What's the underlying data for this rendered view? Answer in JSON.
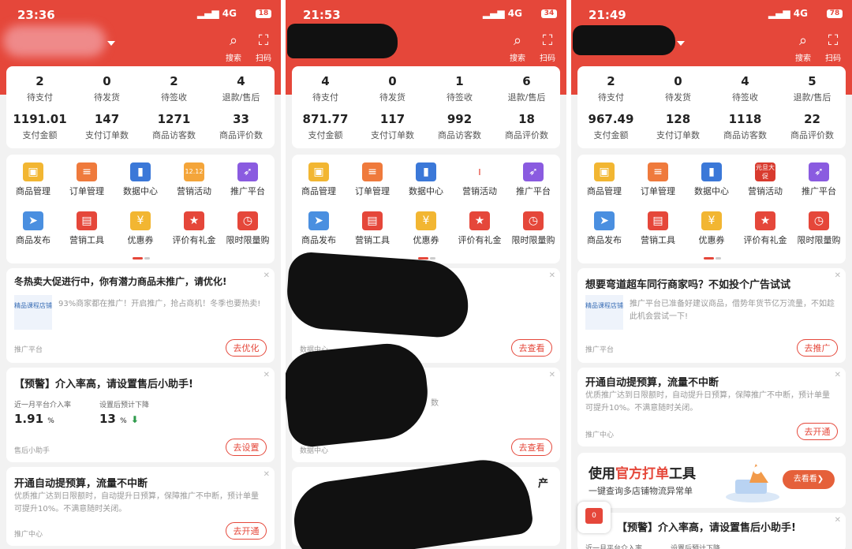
{
  "phones": [
    {
      "status": {
        "time": "23:36",
        "signal": "4G",
        "battery": "18"
      },
      "header": {
        "search": "搜索",
        "scan": "扫码"
      },
      "stats": [
        {
          "value": "2",
          "label": "待支付"
        },
        {
          "value": "0",
          "label": "待发货"
        },
        {
          "value": "2",
          "label": "待签收"
        },
        {
          "value": "4",
          "label": "退款/售后"
        },
        {
          "value": "1191.01",
          "label": "支付金额"
        },
        {
          "value": "147",
          "label": "支付订单数"
        },
        {
          "value": "1271",
          "label": "商品访客数"
        },
        {
          "value": "33",
          "label": "商品评价数"
        }
      ],
      "grid": [
        {
          "label": "商品管理",
          "icon": "bag-icon"
        },
        {
          "label": "订单管理",
          "icon": "scroll-icon"
        },
        {
          "label": "数据中心",
          "icon": "bar-chart-icon"
        },
        {
          "label": "营销活动",
          "icon": "gift-1212-icon",
          "icon_text": "12.12"
        },
        {
          "label": "推广平台",
          "icon": "rocket-icon"
        },
        {
          "label": "商品发布",
          "icon": "paper-plane-icon"
        },
        {
          "label": "营销工具",
          "icon": "toolbox-icon"
        },
        {
          "label": "优惠券",
          "icon": "ticket-icon"
        },
        {
          "label": "评价有礼金",
          "icon": "star-icon"
        },
        {
          "label": "限时限量购",
          "icon": "clock-icon"
        }
      ],
      "cards": {
        "c1": {
          "title": "冬热卖大促进行中，你有潜力商品未推广，请优化!",
          "thumb": "精品课程店铺",
          "desc": "93%商家都在推广！开启推广，抢占商机！冬季也要热卖!",
          "source": "推广平台",
          "button": "去优化"
        },
        "c2": {
          "title": "【预警】介入率高，请设置售后小助手!",
          "m1_label": "近一月平台介入率",
          "m1_value": "1.91",
          "m1_unit": "%",
          "m2_label": "设置后预计下降",
          "m2_value": "13",
          "m2_unit": "%",
          "source": "售后小助手",
          "button": "去设置"
        },
        "c3": {
          "title": "开通自动提预算，流量不中断",
          "desc": "优质推广达到日限额时，自动提升日预算，保障推广不中断，预计单量可提升10%。不满意随时关闭。",
          "source": "推广中心",
          "button": "去开通"
        }
      }
    },
    {
      "status": {
        "time": "21:53",
        "signal": "4G",
        "battery": "34"
      },
      "header": {
        "search": "搜索",
        "scan": "扫码"
      },
      "stats": [
        {
          "value": "4",
          "label": "待支付"
        },
        {
          "value": "0",
          "label": "待发货"
        },
        {
          "value": "1",
          "label": "待签收"
        },
        {
          "value": "6",
          "label": "退款/售后"
        },
        {
          "value": "871.77",
          "label": "支付金额"
        },
        {
          "value": "117",
          "label": "支付订单数"
        },
        {
          "value": "992",
          "label": "商品访客数"
        },
        {
          "value": "18",
          "label": "商品评价数"
        }
      ],
      "grid": [
        {
          "label": "商品管理",
          "icon": "bag-icon"
        },
        {
          "label": "订单管理",
          "icon": "scroll-icon"
        },
        {
          "label": "数据中心",
          "icon": "bar-chart-icon"
        },
        {
          "label": "营销活动",
          "icon": "bar-icon"
        },
        {
          "label": "推广平台",
          "icon": "rocket-icon"
        },
        {
          "label": "商品发布",
          "icon": "paper-plane-icon"
        },
        {
          "label": "营销工具",
          "icon": "toolbox-icon"
        },
        {
          "label": "优惠券",
          "icon": "ticket-icon"
        },
        {
          "label": "评价有礼金",
          "icon": "star-icon"
        },
        {
          "label": "限时限量购",
          "icon": "clock-icon"
        }
      ],
      "cards": {
        "s1": {
          "source": "数据中心",
          "button": "去查看"
        },
        "s2": {
          "fragment": "数",
          "source": "数据中心",
          "button": "去查看"
        },
        "s3": {
          "fragment": "产"
        }
      }
    },
    {
      "status": {
        "time": "21:49",
        "signal": "4G",
        "battery": "78"
      },
      "header": {
        "search": "搜索",
        "scan": "扫码"
      },
      "stats": [
        {
          "value": "2",
          "label": "待支付"
        },
        {
          "value": "0",
          "label": "待发货"
        },
        {
          "value": "4",
          "label": "待签收"
        },
        {
          "value": "5",
          "label": "退款/售后"
        },
        {
          "value": "967.49",
          "label": "支付金额"
        },
        {
          "value": "128",
          "label": "支付订单数"
        },
        {
          "value": "1118",
          "label": "商品访客数"
        },
        {
          "value": "22",
          "label": "商品评价数"
        }
      ],
      "grid": [
        {
          "label": "商品管理",
          "icon": "bag-icon"
        },
        {
          "label": "订单管理",
          "icon": "scroll-icon"
        },
        {
          "label": "数据中心",
          "icon": "bar-chart-icon"
        },
        {
          "label": "营销活动",
          "icon": "new-year-promo-icon",
          "icon_text": "元旦大促"
        },
        {
          "label": "推广平台",
          "icon": "rocket-icon"
        },
        {
          "label": "商品发布",
          "icon": "paper-plane-icon"
        },
        {
          "label": "营销工具",
          "icon": "toolbox-icon"
        },
        {
          "label": "优惠券",
          "icon": "ticket-icon"
        },
        {
          "label": "评价有礼金",
          "icon": "star-icon"
        },
        {
          "label": "限时限量购",
          "icon": "clock-icon"
        }
      ],
      "cards": {
        "c1": {
          "title": "想要弯道超车同行商家吗？不如投个广告试试",
          "thumb": "精品课程店铺",
          "desc": "推广平台已准备好建议商品，借势年货节亿万流量，不如趁此机会尝试一下!",
          "source": "推广平台",
          "button": "去推广"
        },
        "c2": {
          "title": "开通自动提预算，流量不中断",
          "desc": "优质推广达到日限额时，自动提升日预算，保障推广不中断，预计单量可提升10%。不满意随时关闭。",
          "source": "推广中心",
          "button": "去开通"
        },
        "promo": {
          "title_a": "使用",
          "title_b": "官方打单",
          "title_c": "工具",
          "subtitle": "一键查询多店铺物流异常单",
          "button": "去看看❯"
        },
        "c3": {
          "title": "【预警】介入率高，请设置售后小助手!",
          "m1_label": "近一月平台介入率",
          "m2_label": "设置后预计下降"
        },
        "float_badge": "0"
      }
    }
  ],
  "colors": {
    "brand": "#e5473a",
    "accent_green": "#2e9a4b"
  }
}
